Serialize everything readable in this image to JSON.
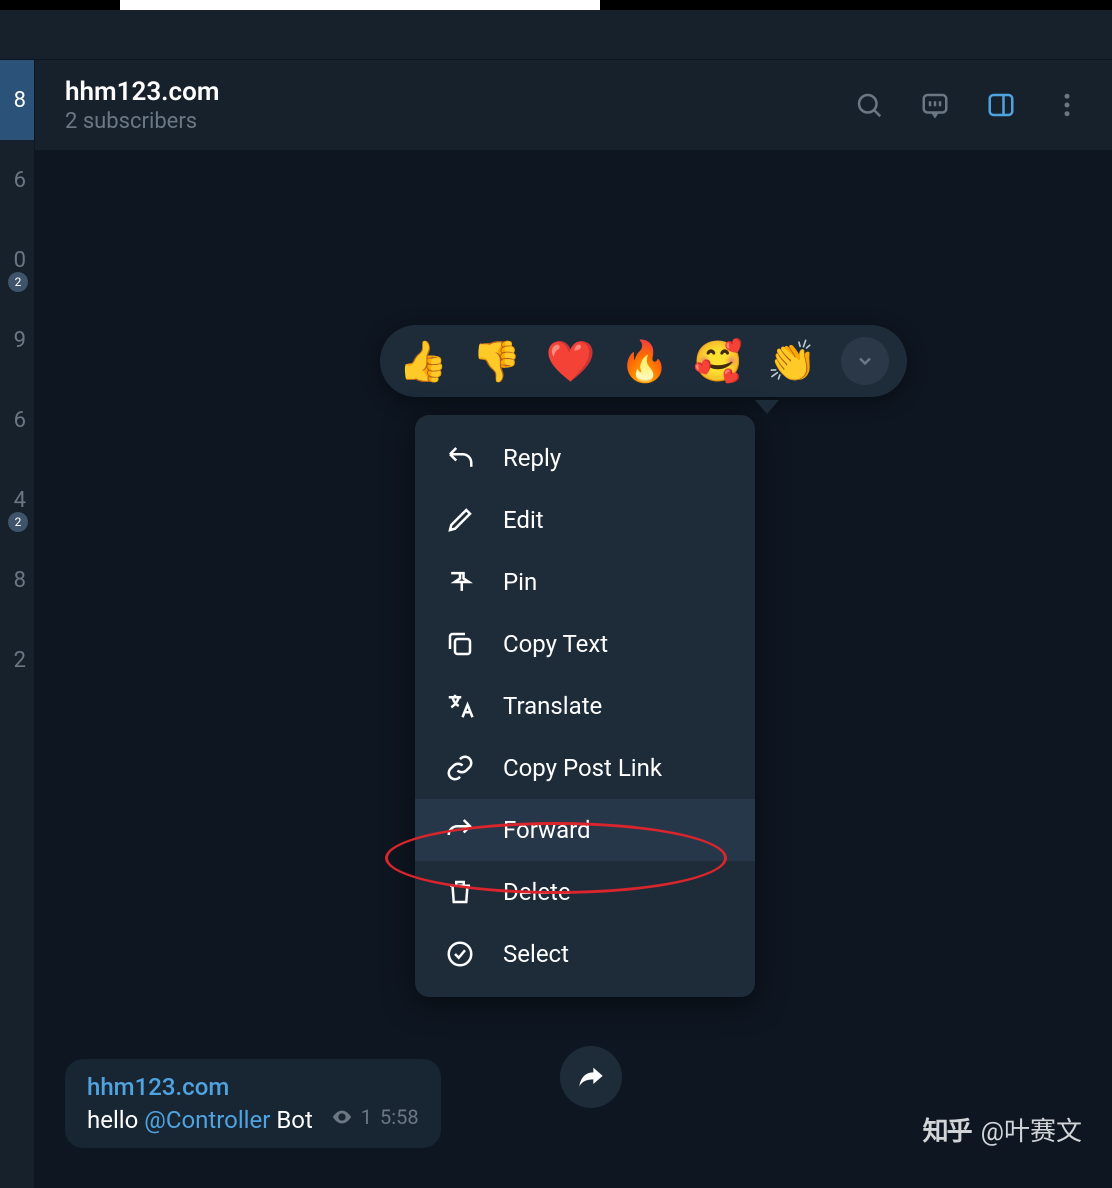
{
  "header": {
    "title": "hhm123.com",
    "subtitle": "2 subscribers"
  },
  "sidebar_strip": [
    {
      "num": "8",
      "active": true
    },
    {
      "num": "6"
    },
    {
      "num": "0"
    },
    {
      "num": "9"
    },
    {
      "num": "6"
    },
    {
      "num": "4"
    },
    {
      "num": "8"
    },
    {
      "num": "2"
    }
  ],
  "reactions": [
    "👍",
    "👎",
    "❤️",
    "🔥",
    "🥰",
    "👏"
  ],
  "menu": [
    {
      "icon": "reply",
      "label": "Reply"
    },
    {
      "icon": "edit",
      "label": "Edit"
    },
    {
      "icon": "pin",
      "label": "Pin"
    },
    {
      "icon": "copy",
      "label": "Copy Text"
    },
    {
      "icon": "translate",
      "label": "Translate"
    },
    {
      "icon": "link",
      "label": "Copy Post Link"
    },
    {
      "icon": "forward",
      "label": "Forward",
      "highlight": true
    },
    {
      "icon": "delete",
      "label": "Delete"
    },
    {
      "icon": "select",
      "label": "Select"
    }
  ],
  "message": {
    "sender": "hhm123.com",
    "text_before": "hello ",
    "mention": "@Controller",
    "text_after": " Bot",
    "views": "1",
    "time": "5:58"
  },
  "watermark": {
    "logo": "知乎",
    "user": "@叶赛文"
  }
}
